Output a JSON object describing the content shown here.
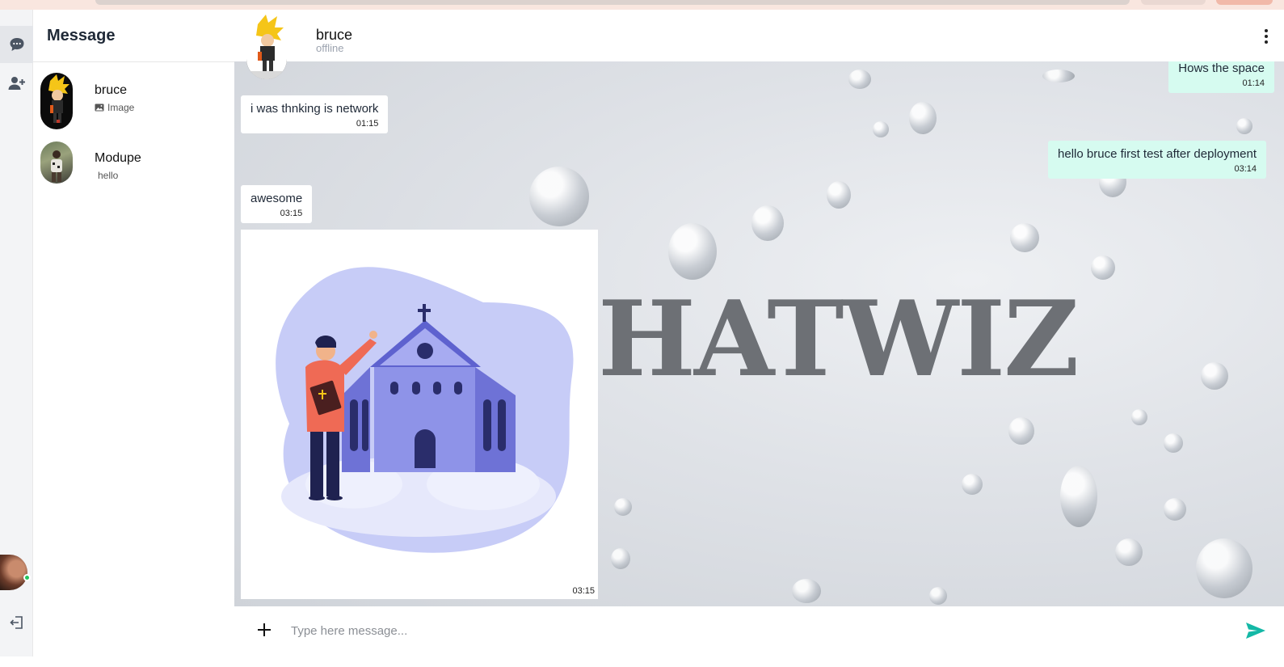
{
  "rail": {
    "items": [
      {
        "name": "chats",
        "icon": "chat-bubble-icon",
        "active": true
      },
      {
        "name": "add-contact",
        "icon": "user-plus-icon",
        "active": false
      }
    ],
    "presence_color": "#22c55e",
    "logout_icon": "logout-icon"
  },
  "sidebar": {
    "title": "Message",
    "conversations": [
      {
        "name": "bruce",
        "preview": "Image",
        "preview_icon": "image-icon"
      },
      {
        "name": "Modupe",
        "preview": "hello"
      }
    ]
  },
  "chat": {
    "contact_name": "bruce",
    "contact_status": "offline",
    "menu_icon": "kebab-menu-icon",
    "watermark": "HATWIZ",
    "messages": [
      {
        "direction": "out",
        "text": "Hows the space",
        "time": "01:14"
      },
      {
        "direction": "in",
        "text": "i was thnking is network",
        "time": "01:15"
      },
      {
        "direction": "out",
        "text": "hello bruce first test after deployment",
        "time": "03:14"
      },
      {
        "direction": "in",
        "text": "awesome",
        "time": "03:15"
      },
      {
        "direction": "in",
        "type": "image",
        "image": "church-illustration",
        "time": "03:15"
      }
    ],
    "composer": {
      "placeholder": "Type here message...",
      "attach_icon": "plus-icon",
      "send_icon": "send-icon"
    }
  },
  "colors": {
    "accent": "#14b8a6",
    "outgoing_bubble": "#d6fbf0",
    "incoming_bubble": "#ffffff"
  }
}
